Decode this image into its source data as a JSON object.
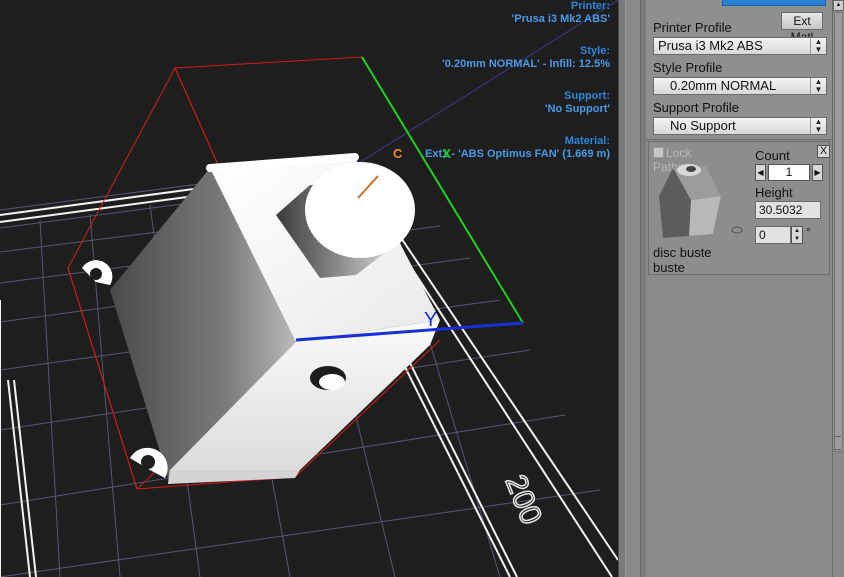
{
  "viewport": {
    "printer_label": "Printer:",
    "printer_value": "'Prusa i3 Mk2 ABS'",
    "style_label": "Style:",
    "style_value": "'0.20mm NORMAL' - Infill: 12.5%",
    "support_label": "Support:",
    "support_value": "'No Support'",
    "material_label": "Material:",
    "material_value": "Ext1 - 'ABS Optimus FAN' (1.669 m)",
    "ext_marker_c": "C",
    "ext_marker_x": "X",
    "axis_y_label": "Y",
    "bed_label": "200"
  },
  "panel": {
    "ext_button": "Ext Matl",
    "printer_profile_label": "Printer Profile",
    "printer_profile_value": "Prusa i3 Mk2 ABS",
    "style_profile_label": "Style Profile",
    "style_profile_value": "0.20mm NORMAL",
    "support_profile_label": "Support Profile",
    "support_profile_value": "No Support",
    "object": {
      "lock_paths_label": "Lock Paths",
      "close_label": "X",
      "count_label": "Count",
      "count_value": "1",
      "height_label": "Height",
      "height_value": "30.5032",
      "rotation_value": "0",
      "degree_symbol": "°",
      "name_line1": "disc buste",
      "name_line2": "buste"
    }
  },
  "colors": {
    "info_label": "#2f86d8",
    "axis_x": "#22d022",
    "axis_y": "#1a2ed8",
    "bbox": "#d21c1c",
    "ext_marker": "#f08a2a",
    "panel_bg": "#8a8a8a"
  }
}
